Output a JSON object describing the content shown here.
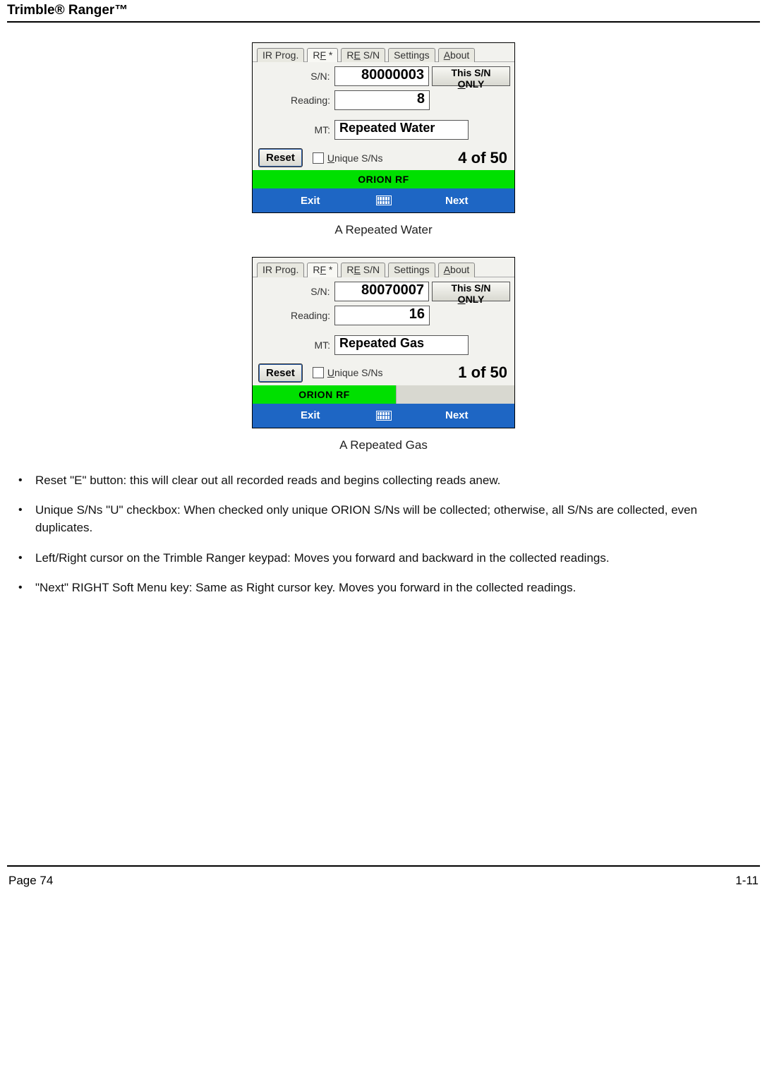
{
  "header": {
    "title": "Trimble® Ranger™"
  },
  "captions": {
    "water": "A Repeated Water",
    "gas": "A Repeated Gas"
  },
  "tabs": {
    "ir": "IR Prog.",
    "rf_prefix": "R",
    "rf_ul": "F",
    "rf_suffix": " *",
    "resn_prefix": "R",
    "resn_ul": "E",
    "resn_suffix": " S/N",
    "settings": "Settings",
    "about_ul": "A",
    "about_suffix": "bout"
  },
  "labels": {
    "sn": "S/N:",
    "reading": "Reading:",
    "mt": "MT:"
  },
  "btn_snonly": {
    "prefix": "This S/N ",
    "ul": "O",
    "suffix": "NLY"
  },
  "btn_reset": "Reset",
  "checkbox": {
    "ul": "U",
    "rest": "nique S/Ns"
  },
  "orion_label": "ORION RF",
  "softbar": {
    "exit": "Exit",
    "next": "Next"
  },
  "shot_water": {
    "sn": "80000003",
    "reading": "8",
    "mt": "Repeated Water",
    "counter": "4 of 50"
  },
  "shot_gas": {
    "sn": "80070007",
    "reading": "16",
    "mt": "Repeated Gas",
    "counter": "1 of 50"
  },
  "bullets": [
    "Reset \"E\" button: this will clear out all recorded reads and begins collecting reads anew.",
    "Unique S/Ns \"U\" checkbox: When checked only unique ORION S/Ns will be collected; otherwise, all S/Ns are collected, even duplicates.",
    "Left/Right cursor on the Trimble Ranger keypad: Moves you forward and backward in the collected readings.",
    "\"Next\" RIGHT Soft Menu key: Same as Right cursor key.  Moves you forward in the collected readings."
  ],
  "footer": {
    "left": "Page 74",
    "right": "1-11"
  }
}
